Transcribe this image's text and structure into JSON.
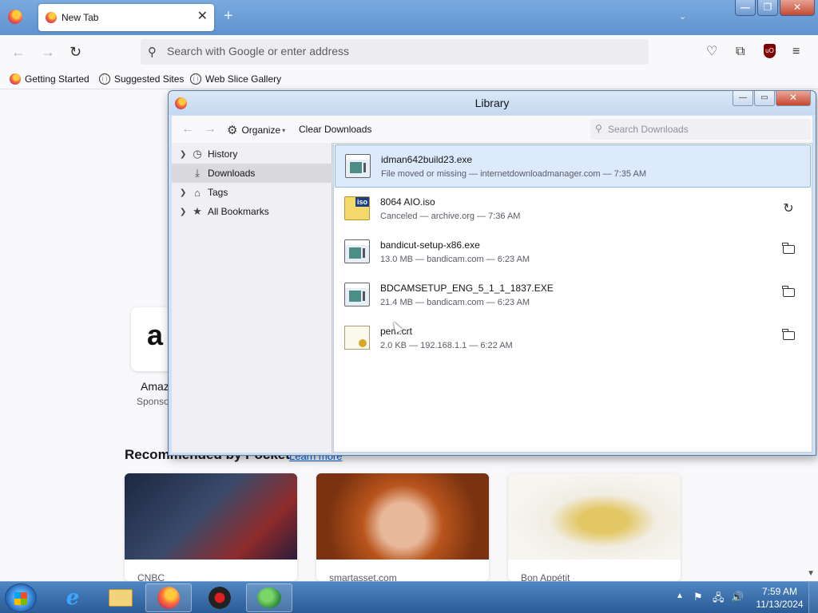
{
  "browser": {
    "tab_title": "New Tab",
    "tab_close": "✕",
    "new_tab": "+",
    "list_all_tabs": "⌄",
    "window_buttons": {
      "minimize": "—",
      "maximize": "❐",
      "close": "✕"
    },
    "url_placeholder": "Search with Google or enter address",
    "bookmarks": [
      "Getting Started",
      "Suggested Sites",
      "Web Slice Gallery"
    ],
    "ublock_label": "uO"
  },
  "newtab_page": {
    "shortcut_letter": "a",
    "shortcut_label": "Amaz",
    "shortcut_sub": "Sponso",
    "pocket_title": "Recommended by Pocket",
    "pocket_link": "Learn more",
    "cards": [
      {
        "source": "CNBC"
      },
      {
        "source": "smartasset.com"
      },
      {
        "source": "Bon Appétit"
      }
    ]
  },
  "library": {
    "title": "Library",
    "window_buttons": {
      "minimize": "—",
      "maximize": "▭",
      "close": "✕"
    },
    "toolbar": {
      "organize": "Organize",
      "clear_downloads": "Clear Downloads",
      "search_placeholder": "Search Downloads"
    },
    "sidebar": [
      {
        "label": "History",
        "icon": "clock-icon",
        "expandable": true
      },
      {
        "label": "Downloads",
        "icon": "download-icon",
        "expandable": false,
        "selected": true
      },
      {
        "label": "Tags",
        "icon": "tag-icon",
        "expandable": true
      },
      {
        "label": "All Bookmarks",
        "icon": "star-icon",
        "expandable": true
      }
    ],
    "downloads": [
      {
        "name": "idman642build23.exe",
        "status": "File moved or missing — internetdownloadmanager.com — 7:35 AM",
        "icon": "exe",
        "action": "",
        "selected": true
      },
      {
        "name": "8064 AIO.iso",
        "status": "Canceled — archive.org — 7:36 AM",
        "icon": "iso",
        "action": "retry"
      },
      {
        "name": "bandicut-setup-x86.exe",
        "status": "13.0 MB — bandicam.com — 6:23 AM",
        "icon": "exe",
        "action": "folder"
      },
      {
        "name": "BDCAMSETUP_ENG_5_1_1_1837.EXE",
        "status": "21.4 MB — bandicam.com — 6:23 AM",
        "icon": "exe",
        "action": "folder"
      },
      {
        "name": "pem.crt",
        "status": "2.0 KB — 192.168.1.1 — 6:22 AM",
        "icon": "crt",
        "action": "folder"
      }
    ],
    "iso_badge": "iso"
  },
  "taskbar": {
    "clock_time": "7:59 AM",
    "clock_date": "11/13/2024"
  }
}
